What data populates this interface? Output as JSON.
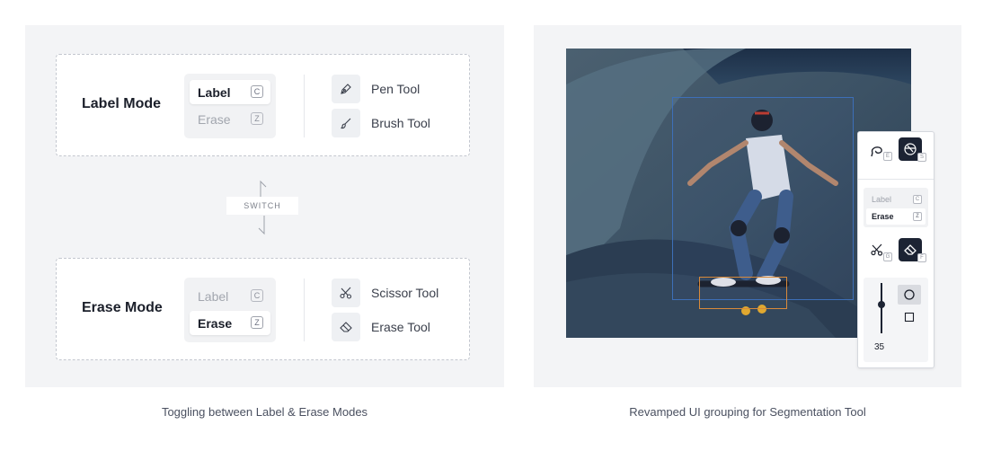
{
  "left_panel": {
    "caption": "Toggling between Label & Erase Modes",
    "switch_label": "SWITCH",
    "label_mode": {
      "title": "Label Mode",
      "toggle": [
        {
          "label": "Label",
          "key": "C",
          "active": true
        },
        {
          "label": "Erase",
          "key": "Z",
          "active": false
        }
      ],
      "tools": [
        {
          "label": "Pen Tool",
          "icon": "pen-icon"
        },
        {
          "label": "Brush Tool",
          "icon": "brush-icon"
        }
      ]
    },
    "erase_mode": {
      "title": "Erase Mode",
      "toggle": [
        {
          "label": "Label",
          "key": "C",
          "active": false
        },
        {
          "label": "Erase",
          "key": "Z",
          "active": true
        }
      ],
      "tools": [
        {
          "label": "Scissor Tool",
          "icon": "scissor-icon"
        },
        {
          "label": "Erase Tool",
          "icon": "eraser-icon"
        }
      ]
    }
  },
  "right_panel": {
    "caption": "Revamped UI grouping for Segmentation Tool",
    "toolbar": {
      "top_tools": [
        {
          "icon": "lasso-icon",
          "key": "E",
          "selected": false
        },
        {
          "icon": "segment-icon",
          "key": "S",
          "selected": true
        }
      ],
      "mode_toggle": [
        {
          "label": "Label",
          "key": "C",
          "active": false
        },
        {
          "label": "Erase",
          "key": "Z",
          "active": true
        }
      ],
      "erase_tools": [
        {
          "icon": "scissor-icon",
          "key": "G",
          "selected": false
        },
        {
          "icon": "eraser-icon",
          "key": "F",
          "selected": true
        }
      ],
      "brush_size": "35",
      "brush_shapes": [
        "circle",
        "square"
      ],
      "selected_shape": "circle"
    },
    "colors": {
      "selection_box": "#3d6fb8",
      "object_box": "#d98a3a",
      "dark_button": "#1c2333"
    }
  }
}
